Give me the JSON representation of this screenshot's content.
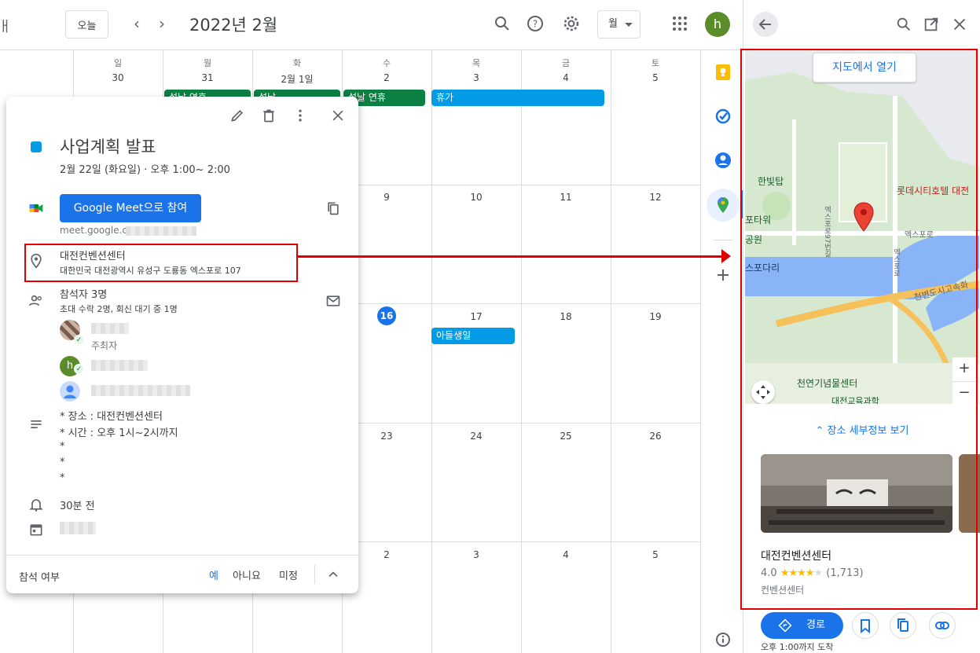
{
  "calendar": {
    "today_button": "오늘",
    "prev": "‹",
    "next": "›",
    "month_title": "2022년 2월",
    "view": "월",
    "avatar_letter": "h",
    "left_edge_char": "ㅐ",
    "weekdays": [
      "일",
      "월",
      "화",
      "수",
      "목",
      "금",
      "토"
    ],
    "rows": [
      [
        "30",
        "31",
        "2월 1일",
        "2",
        "3",
        "4",
        "5"
      ],
      [
        "",
        "",
        "",
        "9",
        "10",
        "11",
        "12"
      ],
      [
        "",
        "",
        "",
        "16",
        "17",
        "18",
        "19"
      ],
      [
        "",
        "",
        "",
        "23",
        "24",
        "25",
        "26"
      ],
      [
        "",
        "",
        "",
        "2",
        "3",
        "4",
        "5"
      ]
    ],
    "events": {
      "seol_mon": "설날 연휴",
      "seol_tue": "설날",
      "seol_wed": "설날 연휴",
      "vacation": "휴가",
      "son_birthday": "아들생일"
    }
  },
  "popup": {
    "title": "사업계획 발표",
    "datetime": "2월 22일 (화요일)  ·  오후 1:00~ 2:00",
    "meet_button": "Google Meet으로 참여",
    "meet_link": "meet.google.co",
    "location_name": "대전컨벤션센터",
    "location_address": "대한민국 대전광역시 유성구 도룡동 엑스포로 107",
    "attendees_title": "참석자 3명",
    "attendees_sub": "초대 수락 2명, 회신 대기 중 1명",
    "organizer_role": "주최자",
    "attendee2_initial": "h",
    "description_lines": [
      "* 장소 : 대전컨벤션센터",
      "* 시간 : 오후 1시~2시까지",
      "*",
      "*",
      "*"
    ],
    "reminder": "30분 전",
    "rsvp_label": "참석 여부",
    "rsvp_yes": "예",
    "rsvp_no": "아니요",
    "rsvp_maybe": "미정"
  },
  "panel": {
    "open_in_maps": "지도에서 열기",
    "map_labels": {
      "hanbit": "한빛탑",
      "lotte": "롯데시티호텔 대전",
      "expo97": "엑스포로97번길",
      "expo": "엑스포로",
      "tower": "포타워",
      "park": "공원",
      "bridge": "스포다리",
      "highway": "천변도시고속화",
      "museum": "천연기념물센터",
      "science": "대전교육과학",
      "road_vert": "엑스포로"
    },
    "zoom_in": "+",
    "zoom_out": "−",
    "details_link": "장소 세부정보 보기",
    "place_name": "대전컨벤션센터",
    "rating_value": "4.0",
    "rating_count": "(1,713)",
    "category": "컨벤션센터",
    "route_button": "경로",
    "arrive_text": "오후 1:00까지 도착"
  },
  "colors": {
    "event_green": "#0b8043",
    "event_blue": "#039be5",
    "primary_blue": "#1a73e8",
    "annotation_red": "#e00000"
  }
}
